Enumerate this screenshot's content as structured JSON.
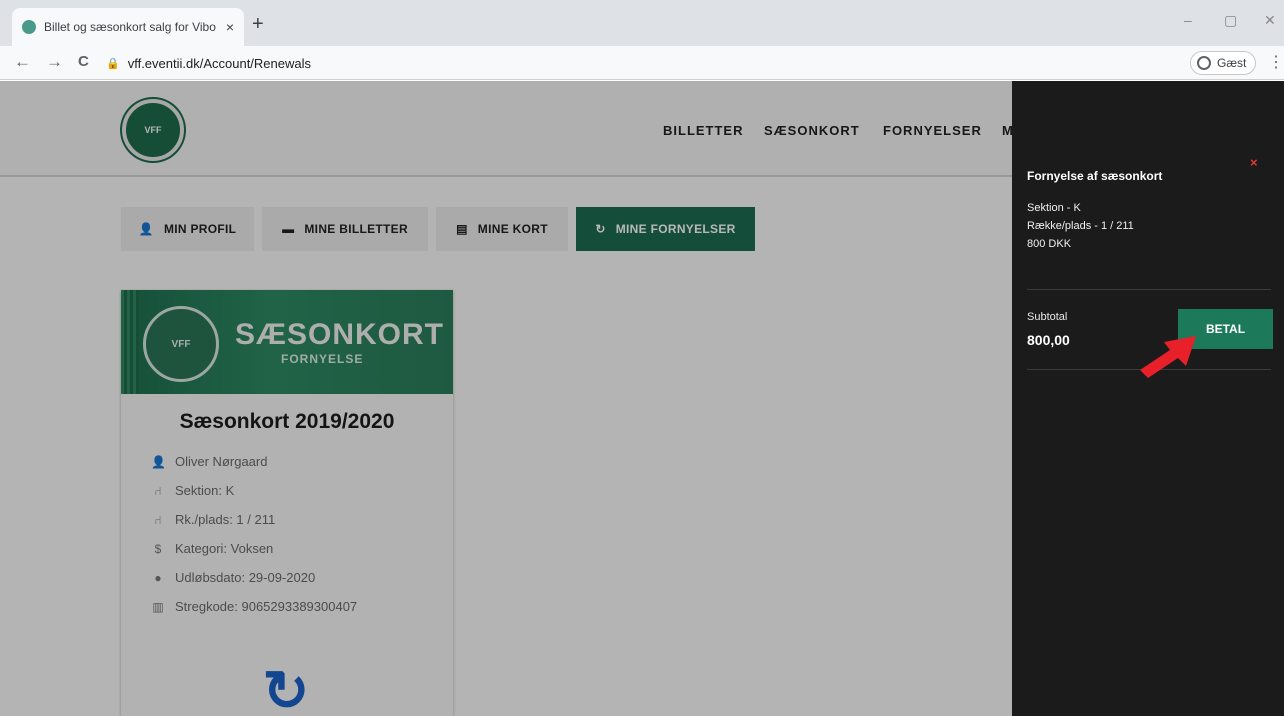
{
  "browser": {
    "tab_title": "Billet og sæsonkort salg for Vibo",
    "tab_close": "×",
    "new_tab": "+",
    "url": "vff.eventii.dk/Account/Renewals",
    "profile_label": "Gæst",
    "minimize": "–",
    "restore": "▢",
    "close": "✕",
    "back": "←",
    "forward": "→",
    "reload": "C",
    "menu": "⋮"
  },
  "nav": {
    "items": [
      "BILLETTER",
      "SÆSONKORT",
      "FORNYELSER",
      "M"
    ]
  },
  "account_tabs": [
    {
      "label": "MIN PROFIL",
      "icon": "user-icon",
      "active": false
    },
    {
      "label": "MINE BILLETTER",
      "icon": "ticket-icon",
      "active": false
    },
    {
      "label": "MINE KORT",
      "icon": "card-icon",
      "active": false
    },
    {
      "label": "MINE FORNYELSER",
      "icon": "refresh-icon",
      "active": true
    }
  ],
  "card": {
    "banner_title": "SÆSONKORT",
    "banner_subtitle": "FORNYELSE",
    "title": "Sæsonkort 2019/2020",
    "details": [
      {
        "icon": "user-icon",
        "text": "Oliver Nørgaard"
      },
      {
        "icon": "seat-icon",
        "text": "Sektion: K"
      },
      {
        "icon": "seat-icon",
        "text": "Rk./plads: 1 / 211"
      },
      {
        "icon": "dollar-icon",
        "text": "Kategori: Voksen"
      },
      {
        "icon": "clock-icon",
        "text": "Udløbsdato: 29-09-2020"
      },
      {
        "icon": "barcode-icon",
        "text": "Stregkode: 9065293389300407"
      }
    ]
  },
  "cart": {
    "close": "×",
    "heading": "Fornyelse af sæsonkort",
    "section": "Sektion - K",
    "seat": "Række/plads - 1 / 211",
    "price": "800 DKK",
    "subtotal_label": "Subtotal",
    "subtotal_value": "800,00",
    "pay_label": "BETAL"
  },
  "colors": {
    "brand_green": "#1c6b50",
    "cart_bg": "#1b1b1b",
    "arrow_red": "#e8202a"
  }
}
